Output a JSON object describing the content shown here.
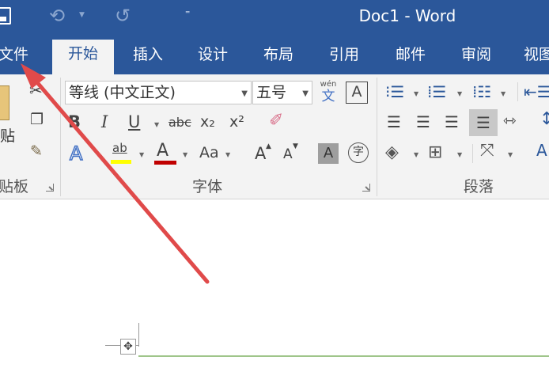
{
  "window": {
    "title": "Doc1 - Word",
    "quick_access": {
      "customize_glyph": "⁼"
    }
  },
  "ribbon_tabs": [
    {
      "label": "文件"
    },
    {
      "label": "开始",
      "active": true
    },
    {
      "label": "插入"
    },
    {
      "label": "设计"
    },
    {
      "label": "布局"
    },
    {
      "label": "引用"
    },
    {
      "label": "邮件"
    },
    {
      "label": "审阅"
    },
    {
      "label": "视图"
    }
  ],
  "clipboard_group": {
    "paste_label": "贴",
    "group_label": "贴板"
  },
  "font_group": {
    "font_name": "等线 (中文正文)",
    "font_size": "五号",
    "phonetic_guide_top": "wén",
    "phonetic_guide_bottom": "文",
    "char_border": "A",
    "bold": "B",
    "italic": "I",
    "underline": "U",
    "strikethrough": "abc",
    "subscript": "x₂",
    "superscript": "x²",
    "text_effects": "A",
    "highlight": "ab",
    "font_color": "A",
    "change_case": "Aa",
    "grow_font": "A",
    "shrink_font": "A",
    "char_shading": "A",
    "enclose_char": "字",
    "group_label": "字体"
  },
  "paragraph_group": {
    "group_label": "段落",
    "sort_glyph": "A"
  },
  "colors": {
    "title_bar": "#2b579a",
    "ribbon_bg": "#f3f3f3",
    "highlight_yellow": "#ffff00",
    "font_color_red": "#c00000",
    "annotation_red": "#e04a4a"
  },
  "icons": [
    "save-icon",
    "undo-icon",
    "redo-icon",
    "customize-qat-icon",
    "cut-icon",
    "copy-icon",
    "format-painter-icon",
    "clear-formatting-icon",
    "bullets-icon",
    "numbering-icon",
    "multilevel-list-icon",
    "decrease-indent-icon",
    "align-left-icon",
    "align-center-icon",
    "align-right-icon",
    "justify-icon",
    "distributed-icon",
    "line-spacing-icon",
    "shading-icon",
    "borders-icon",
    "asian-layout-icon",
    "table-move-handle-icon"
  ]
}
